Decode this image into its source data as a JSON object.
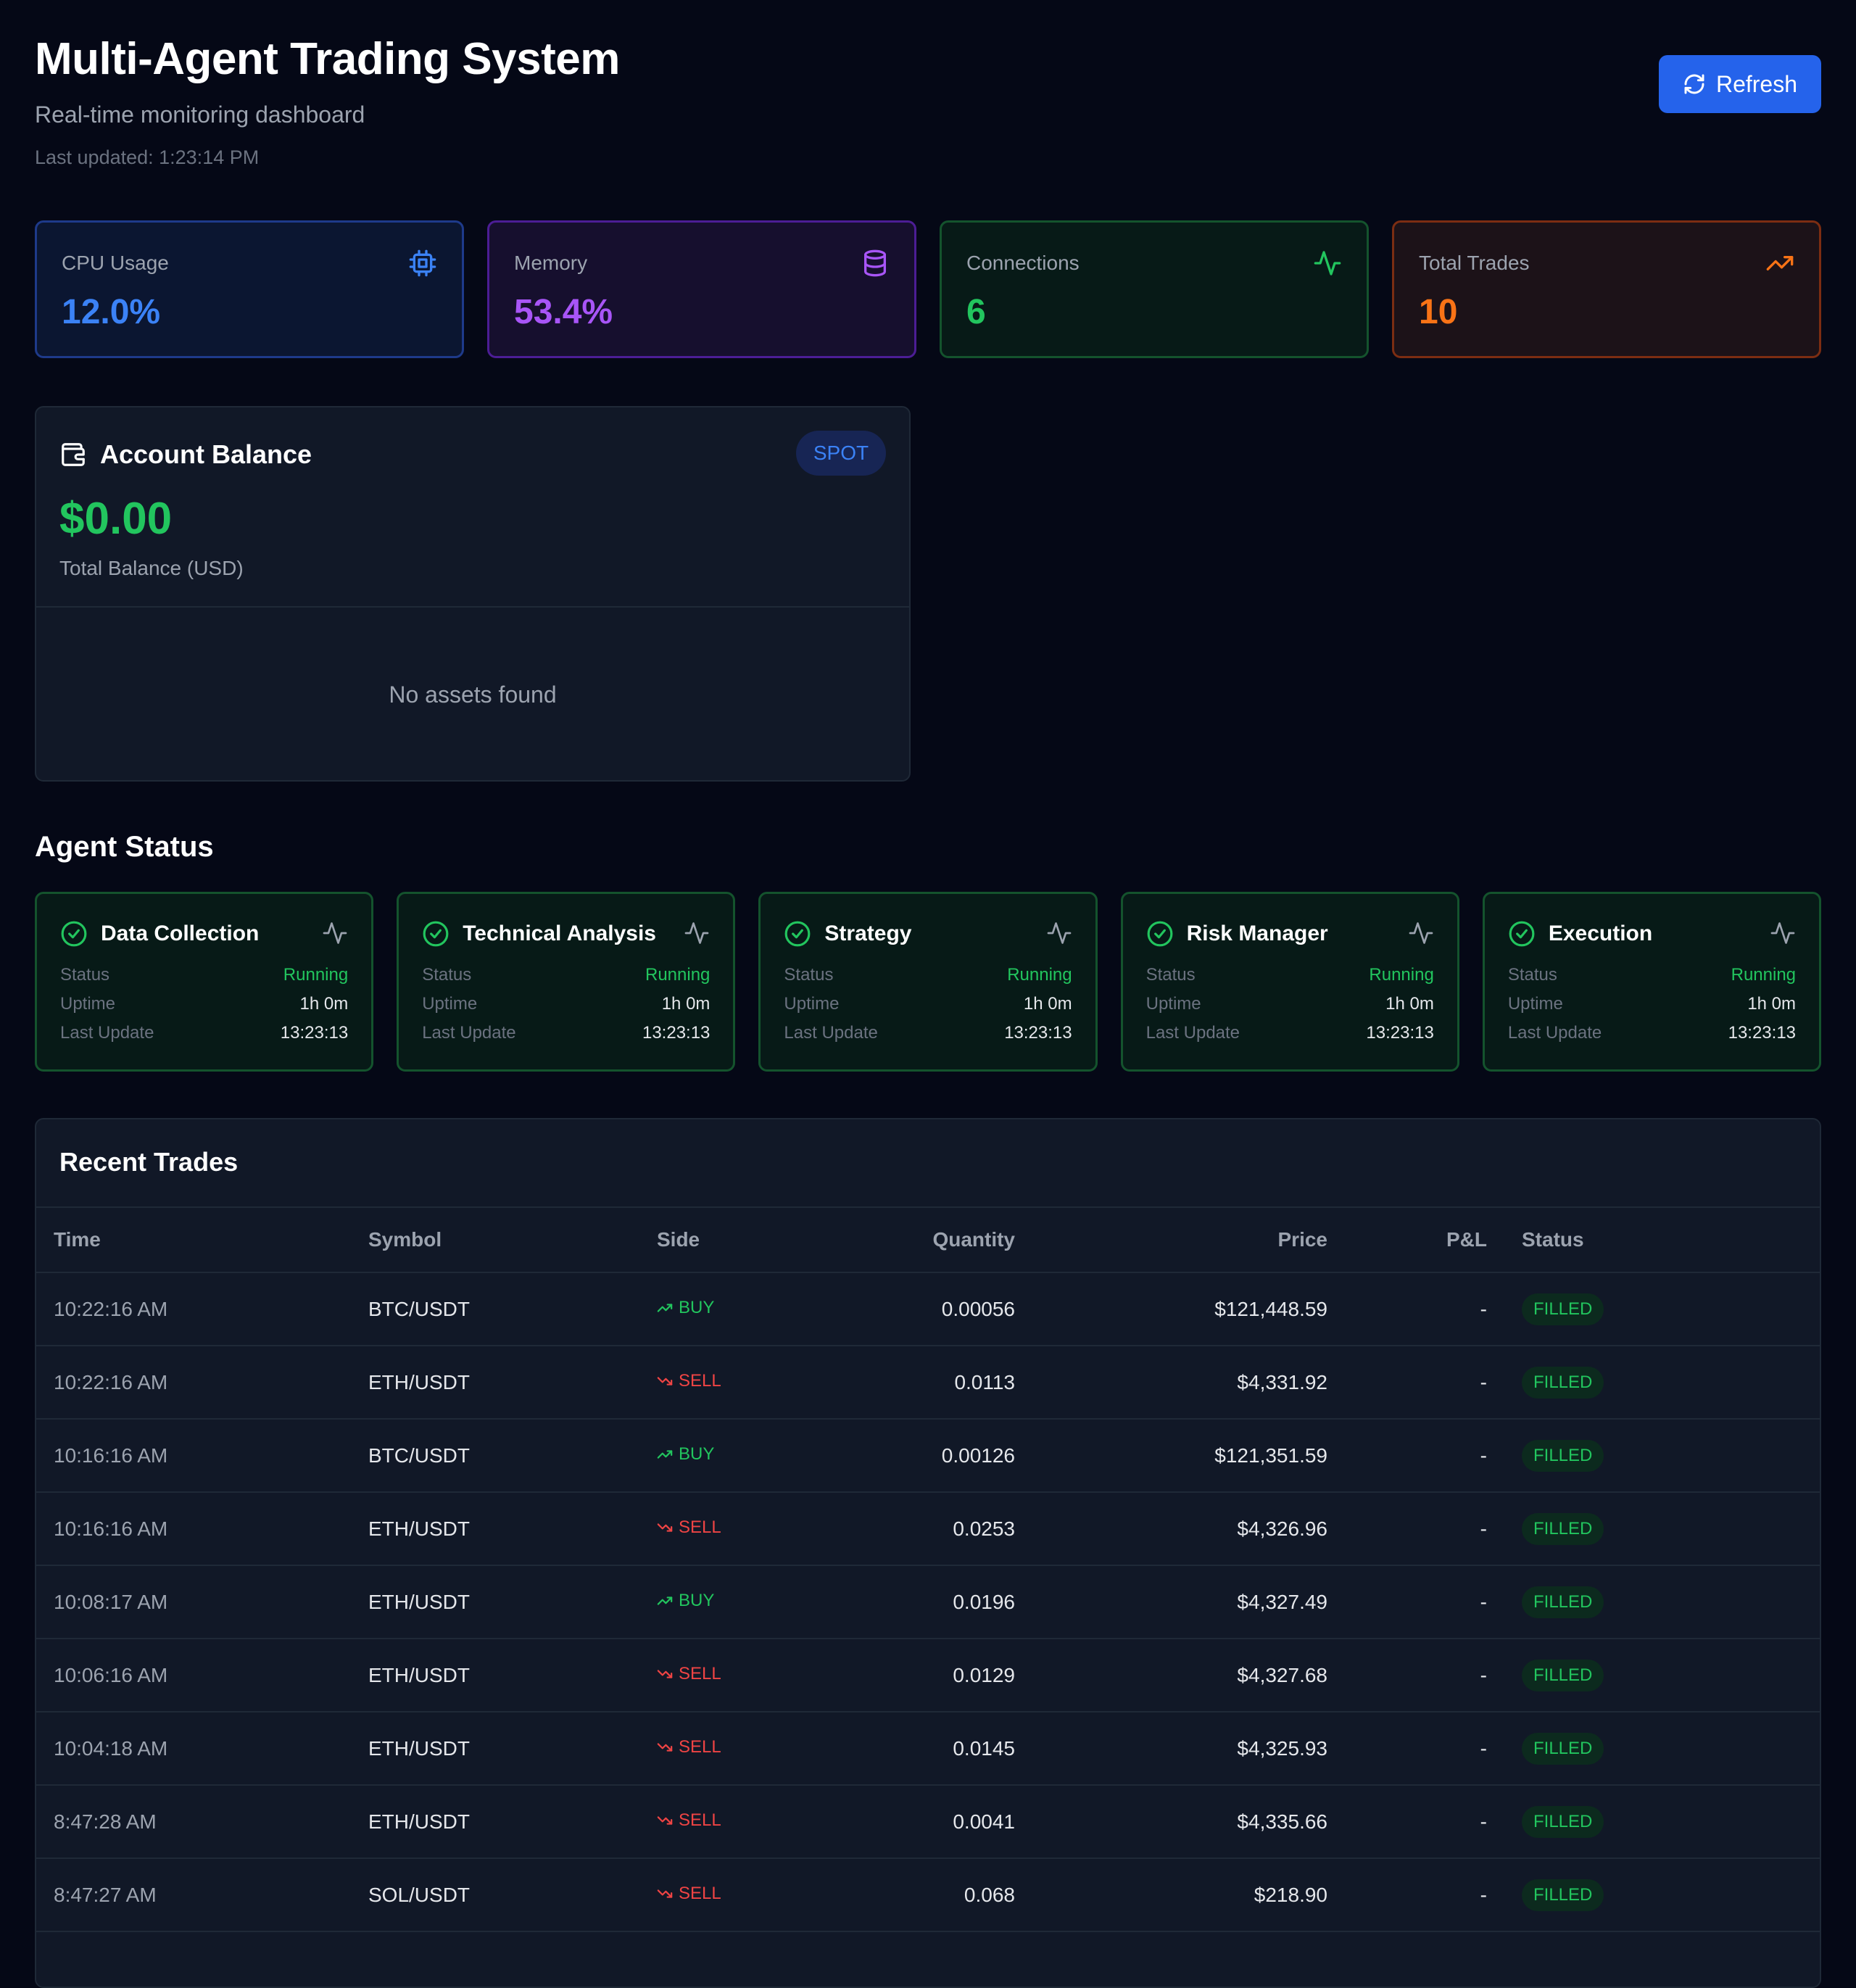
{
  "header": {
    "title": "Multi-Agent Trading System",
    "subtitle": "Real-time monitoring dashboard",
    "last_updated": "Last updated: 1:23:14 PM",
    "refresh_label": "Refresh"
  },
  "metrics": [
    {
      "label": "CPU Usage",
      "value": "12.0%",
      "icon": "cpu-icon",
      "color": "#3b82f6"
    },
    {
      "label": "Memory",
      "value": "53.4%",
      "icon": "database-icon",
      "color": "#a855f7"
    },
    {
      "label": "Connections",
      "value": "6",
      "icon": "activity-icon",
      "color": "#22c55e"
    },
    {
      "label": "Total Trades",
      "value": "10",
      "icon": "trending-up-icon",
      "color": "#f97316"
    }
  ],
  "balance": {
    "title": "Account Balance",
    "badge": "SPOT",
    "amount": "$0.00",
    "caption": "Total Balance (USD)",
    "empty_text": "No assets found"
  },
  "agents_section": {
    "title": "Agent Status",
    "row_labels": {
      "status": "Status",
      "uptime": "Uptime",
      "last_update": "Last Update"
    },
    "agents": [
      {
        "name": "Data Collection",
        "status": "Running",
        "uptime": "1h 0m",
        "last_update": "13:23:13"
      },
      {
        "name": "Technical Analysis",
        "status": "Running",
        "uptime": "1h 0m",
        "last_update": "13:23:13"
      },
      {
        "name": "Strategy",
        "status": "Running",
        "uptime": "1h 0m",
        "last_update": "13:23:13"
      },
      {
        "name": "Risk Manager",
        "status": "Running",
        "uptime": "1h 0m",
        "last_update": "13:23:13"
      },
      {
        "name": "Execution",
        "status": "Running",
        "uptime": "1h 0m",
        "last_update": "13:23:13"
      }
    ]
  },
  "trades": {
    "title": "Recent Trades",
    "columns": [
      "Time",
      "Symbol",
      "Side",
      "Quantity",
      "Price",
      "P&L",
      "Status"
    ],
    "rows": [
      {
        "time": "10:22:16 AM",
        "symbol": "BTC/USDT",
        "side": "BUY",
        "quantity": "0.00056",
        "price": "$121,448.59",
        "pnl": "-",
        "status": "FILLED"
      },
      {
        "time": "10:22:16 AM",
        "symbol": "ETH/USDT",
        "side": "SELL",
        "quantity": "0.0113",
        "price": "$4,331.92",
        "pnl": "-",
        "status": "FILLED"
      },
      {
        "time": "10:16:16 AM",
        "symbol": "BTC/USDT",
        "side": "BUY",
        "quantity": "0.00126",
        "price": "$121,351.59",
        "pnl": "-",
        "status": "FILLED"
      },
      {
        "time": "10:16:16 AM",
        "symbol": "ETH/USDT",
        "side": "SELL",
        "quantity": "0.0253",
        "price": "$4,326.96",
        "pnl": "-",
        "status": "FILLED"
      },
      {
        "time": "10:08:17 AM",
        "symbol": "ETH/USDT",
        "side": "BUY",
        "quantity": "0.0196",
        "price": "$4,327.49",
        "pnl": "-",
        "status": "FILLED"
      },
      {
        "time": "10:06:16 AM",
        "symbol": "ETH/USDT",
        "side": "SELL",
        "quantity": "0.0129",
        "price": "$4,327.68",
        "pnl": "-",
        "status": "FILLED"
      },
      {
        "time": "10:04:18 AM",
        "symbol": "ETH/USDT",
        "side": "SELL",
        "quantity": "0.0145",
        "price": "$4,325.93",
        "pnl": "-",
        "status": "FILLED"
      },
      {
        "time": "8:47:28 AM",
        "symbol": "ETH/USDT",
        "side": "SELL",
        "quantity": "0.0041",
        "price": "$4,335.66",
        "pnl": "-",
        "status": "FILLED"
      },
      {
        "time": "8:47:27 AM",
        "symbol": "SOL/USDT",
        "side": "SELL",
        "quantity": "0.068",
        "price": "$218.90",
        "pnl": "-",
        "status": "FILLED"
      }
    ]
  }
}
